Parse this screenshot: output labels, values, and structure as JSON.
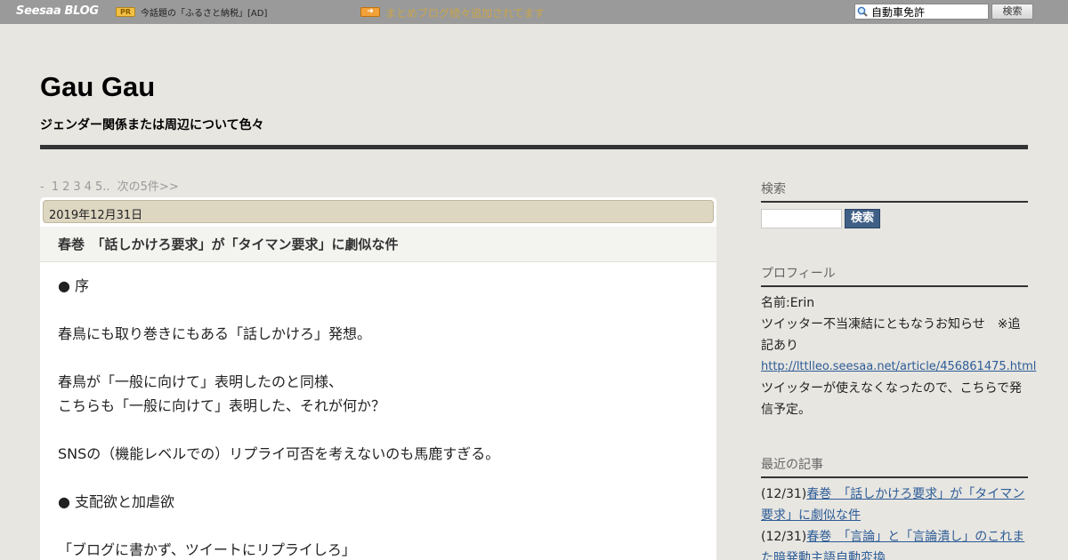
{
  "topbar": {
    "logo_seesaa": "Seesaa",
    "logo_blog": "BLOG",
    "pr_badge": "PR",
    "pr_text": "今話題の「ふるさと納税」[AD]",
    "arrow_icon": "arrow-right-icon",
    "ticker": "まとめブログ続々追加されてます",
    "search_value": "自動車免許",
    "search_button": "検索"
  },
  "header": {
    "title": "Gau Gau",
    "description": "ジェンダー関係または周辺について色々"
  },
  "pager": {
    "prefix": "-",
    "pages": [
      "1",
      "2",
      "3",
      "4",
      "5.."
    ],
    "next": "次の5件>>"
  },
  "article": {
    "date": "2019年12月31日",
    "title": "春巻　「話しかけろ要求」が「タイマン要求」に劇似な件",
    "lines": [
      "● 序",
      "春鳥にも取り巻きにもある「話しかけろ」発想。",
      "春鳥が「一般に向けて」表明したのと同様、",
      "こちらも「一般に向けて」表明した、それが何か？",
      "SNSの（機能レベルでの）リプライ可否を考えないのも馬鹿すぎる。",
      "● 支配欲と加虐欲",
      "「ブログに書かず、ツイートにリプライしろ」"
    ]
  },
  "sidebar": {
    "search_heading": "検索",
    "search_button": "検索",
    "profile_heading": "プロフィール",
    "profile_name": "名前:Erin",
    "profile_notice": "ツイッター不当凍結にともなうお知らせ　※追記あり",
    "profile_link": "http://lttlleo.seesaa.net/article/456861475.html",
    "profile_note": "ツイッターが使えなくなったので、こちらで発信予定。",
    "recent_heading": "最近の記事",
    "recent": [
      {
        "date": "(12/31)",
        "title": "春巻　「話しかけろ要求」が「タイマン要求」に劇似な件"
      },
      {
        "date": "(12/31)",
        "title": "春巻　「言論」と「言論潰し」のこれまた暗発動主語自動変換"
      }
    ]
  },
  "colors": {
    "page_bg": "#e8e6e1",
    "topbar_bg": "#9a9a9a",
    "date_bar_bg": "#ddd6c1",
    "link": "#2c5c97",
    "button_blue": "#3f5f86"
  }
}
